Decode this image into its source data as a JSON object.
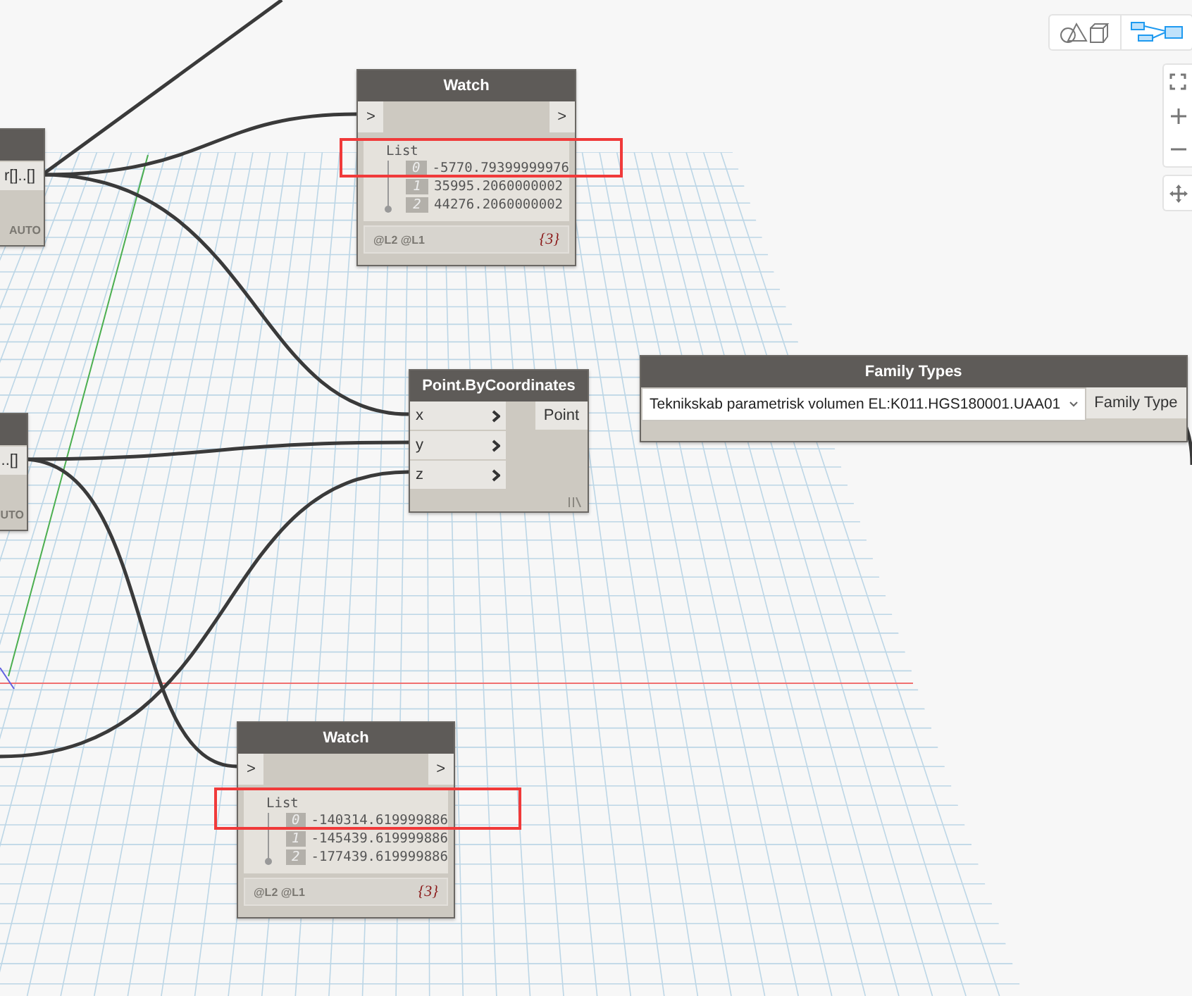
{
  "canvas_toolbar": {
    "buttons": [
      {
        "kind": "geometry",
        "selected": false
      },
      {
        "kind": "graph",
        "selected": true
      }
    ]
  },
  "nodes": [
    {
      "kind": "partial",
      "text": "r[]..[]",
      "footer": "AUTO"
    },
    {
      "kind": "watch",
      "title": "Watch",
      "input": ">",
      "output": ">",
      "list_label": "List",
      "items": [
        {
          "index": "0",
          "value": "-5770.79399999976",
          "highlighted": true
        },
        {
          "index": "1",
          "value": "35995.2060000002",
          "highlighted": false
        },
        {
          "index": "2",
          "value": "44276.2060000002",
          "highlighted": false
        }
      ],
      "levels": "@L2 @L1",
      "count": "{3}"
    },
    {
      "kind": "function",
      "title": "Point.ByCoordinates",
      "inputs": [
        "x",
        "y",
        "z"
      ],
      "output": "Point"
    },
    {
      "kind": "family",
      "title": "Family Types",
      "selection": "Teknikskab parametrisk volumen EL:K011.HGS180001.UAA01",
      "output": "Family Type"
    },
    {
      "kind": "partial",
      "text": "..[]",
      "footer": "UTO"
    },
    {
      "kind": "watch",
      "title": "Watch",
      "input": ">",
      "output": ">",
      "list_label": "List",
      "items": [
        {
          "index": "0",
          "value": "-140314.619999886",
          "highlighted": true
        },
        {
          "index": "1",
          "value": "-145439.619999886",
          "highlighted": false
        },
        {
          "index": "2",
          "value": "-177439.619999886",
          "highlighted": false
        }
      ],
      "levels": "@L2 @L1",
      "count": "{3}"
    }
  ]
}
